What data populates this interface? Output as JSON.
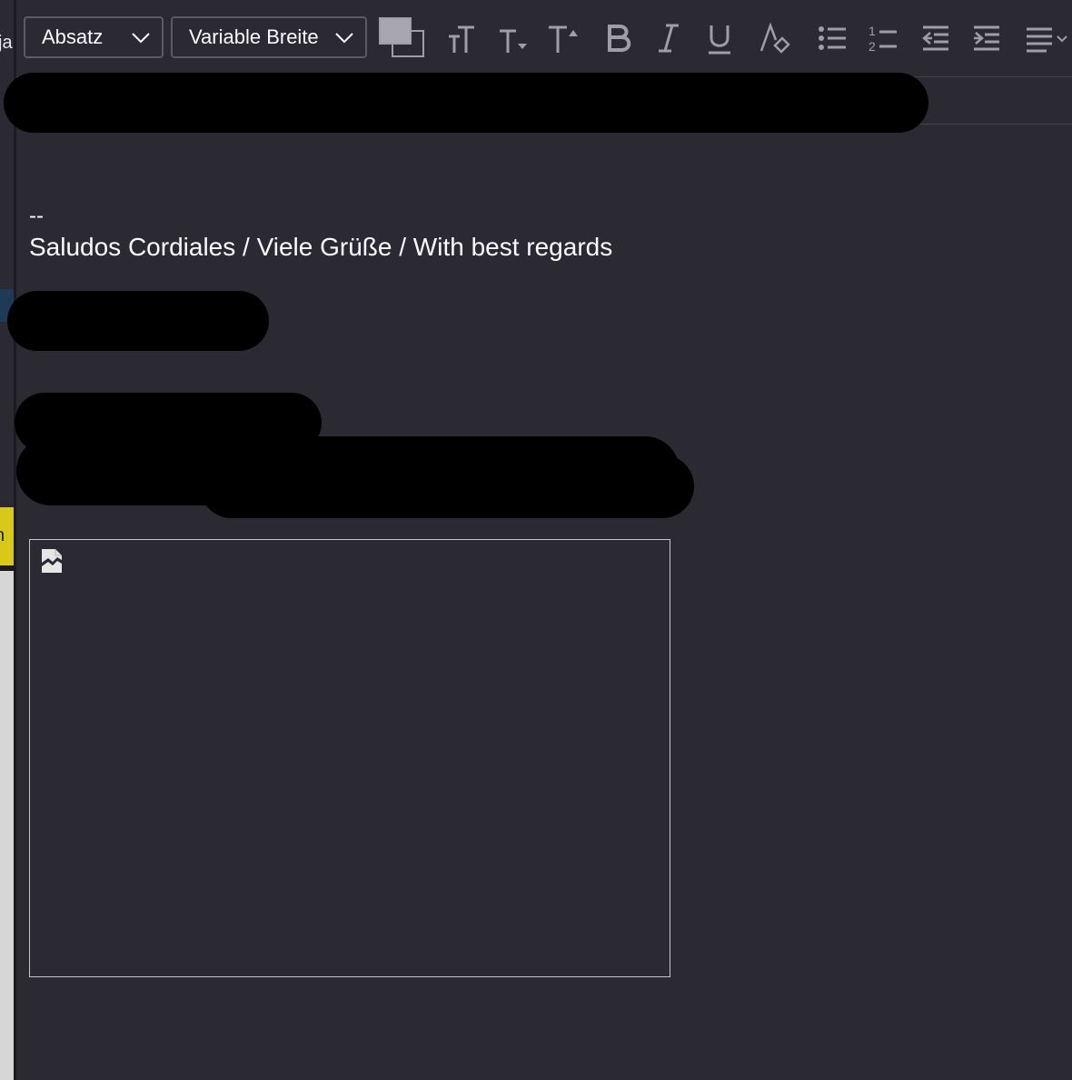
{
  "background_fragments": {
    "left_text_top": "ja",
    "left_text_mid": "n"
  },
  "toolbar": {
    "paragraph_format": "Absatz",
    "font": "Variable Breite",
    "buttons": [
      {
        "name": "color-icon"
      },
      {
        "name": "font-size-reset-icon"
      },
      {
        "name": "font-size-smaller-icon"
      },
      {
        "name": "font-size-larger-icon"
      },
      {
        "name": "bold-icon"
      },
      {
        "name": "italic-icon"
      },
      {
        "name": "underline-icon"
      },
      {
        "name": "clear-format-icon"
      },
      {
        "name": "bulleted-list-icon"
      },
      {
        "name": "numbered-list-icon"
      },
      {
        "name": "outdent-icon"
      },
      {
        "name": "indent-icon"
      },
      {
        "name": "align-icon"
      }
    ]
  },
  "message": {
    "signature_dash": "--",
    "signature_line": "Saludos Cordiales / Viele Grüße / With best regards"
  },
  "colors": {
    "background": "#2b2a33",
    "text": "#fbfbfe",
    "toolbar_icon": "#9f9ea6",
    "redaction": "#000000"
  }
}
